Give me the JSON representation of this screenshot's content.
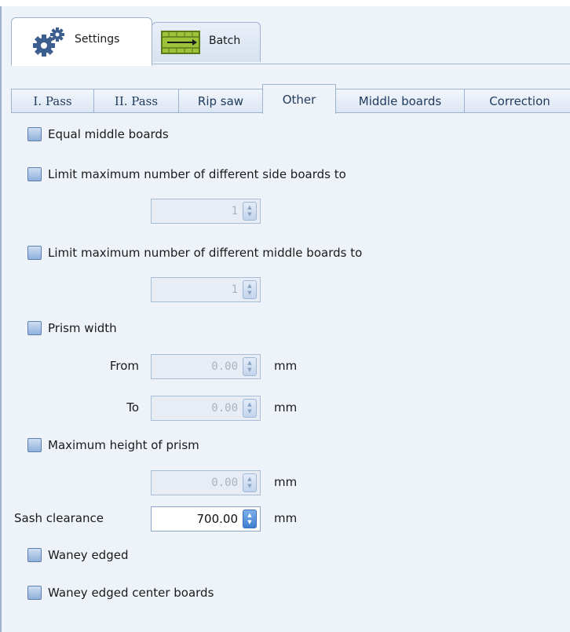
{
  "top_tabs": [
    {
      "label": "Settings",
      "icon": "gear-icon",
      "active": true
    },
    {
      "label": "Batch",
      "icon": "batch-icon",
      "active": false
    }
  ],
  "sub_tabs": [
    {
      "label": "I. Pass"
    },
    {
      "label": "II. Pass"
    },
    {
      "label": "Rip saw"
    },
    {
      "label": "Other",
      "active": true
    },
    {
      "label": "Middle boards"
    },
    {
      "label": "Correction"
    }
  ],
  "options": {
    "equal_middle_boards": {
      "label": "Equal middle boards",
      "checked": false
    },
    "limit_side_boards": {
      "label": "Limit maximum number of different side boards to",
      "checked": false,
      "value": "1"
    },
    "limit_middle_boards": {
      "label": "Limit maximum number of different middle boards to",
      "checked": false,
      "value": "1"
    },
    "prism_width": {
      "label": "Prism width",
      "checked": false,
      "from_label": "From",
      "from_value": "0.00",
      "to_label": "To",
      "to_value": "0.00",
      "unit": "mm"
    },
    "max_height_prism": {
      "label": "Maximum height of prism",
      "checked": false,
      "value": "0.00",
      "unit": "mm"
    },
    "sash_clearance": {
      "label": "Sash clearance",
      "value": "700.00",
      "unit": "mm"
    },
    "waney_edged": {
      "label": "Waney edged",
      "checked": false
    },
    "waney_edged_center": {
      "label": "Waney edged center boards",
      "checked": false
    }
  },
  "colors": {
    "checkbox": "#8fb0dc",
    "panel_bg": "#eef2f9",
    "border": "#9fb3cf",
    "spin_enabled": "#3f7fd0"
  }
}
